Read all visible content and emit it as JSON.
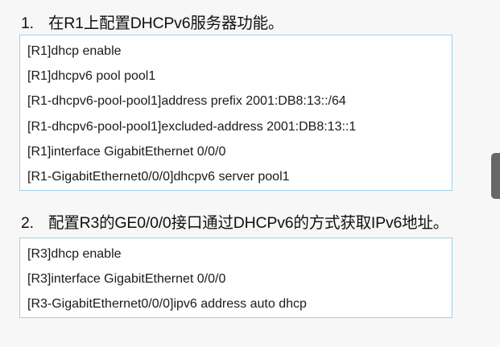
{
  "steps": [
    {
      "number": "1.",
      "title": "在R1上配置DHCPv6服务器功能。",
      "commands": [
        "[R1]dhcp enable",
        "[R1]dhcpv6 pool pool1",
        "[R1-dhcpv6-pool-pool1]address prefix 2001:DB8:13::/64",
        "[R1-dhcpv6-pool-pool1]excluded-address 2001:DB8:13::1",
        "[R1]interface GigabitEthernet 0/0/0",
        "[R1-GigabitEthernet0/0/0]dhcpv6 server pool1"
      ]
    },
    {
      "number": "2.",
      "title": "配置R3的GE0/0/0接口通过DHCPv6的方式获取IPv6地址。",
      "commands": [
        "[R3]dhcp enable",
        "[R3]interface GigabitEthernet 0/0/0",
        "[R3-GigabitEthernet0/0/0]ipv6 address auto dhcp"
      ]
    }
  ],
  "colors": {
    "page_background": "#f7f7f7",
    "code_box_background": "#ffffff",
    "code_box_border": "#9fd0ea",
    "side_tab": "#676767"
  }
}
